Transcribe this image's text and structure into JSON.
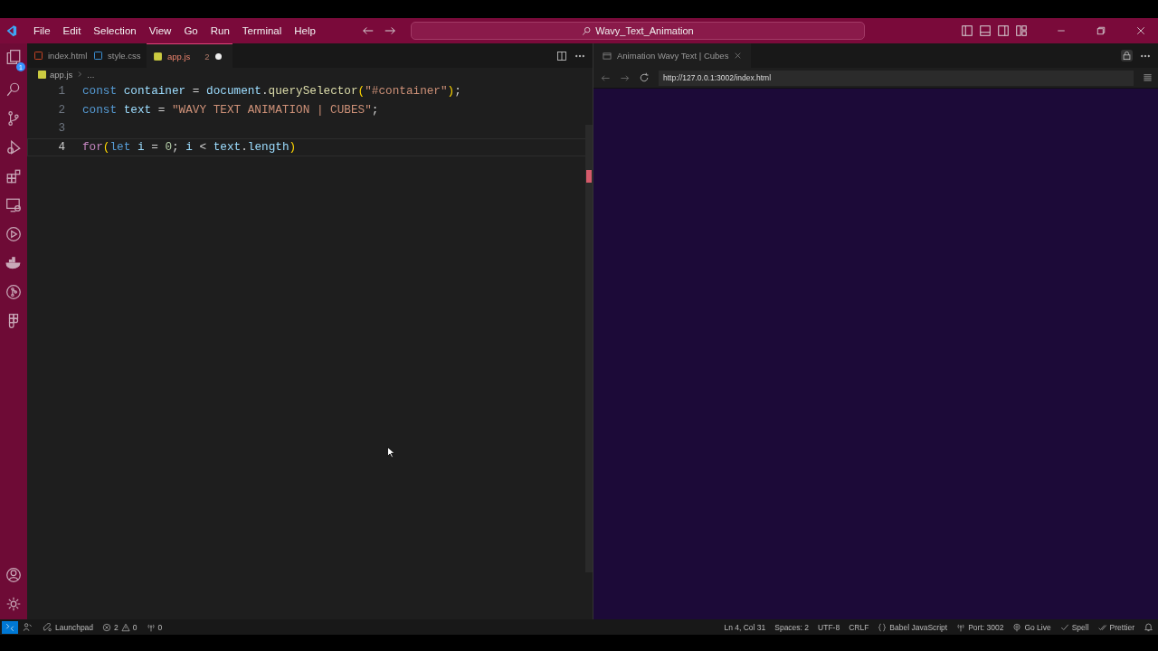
{
  "menu": [
    "File",
    "Edit",
    "Selection",
    "View",
    "Go",
    "Run",
    "Terminal",
    "Help"
  ],
  "command_center": {
    "title": "Wavy_Text_Animation"
  },
  "activity_bar": {
    "explorer_badge": "1"
  },
  "editor_tabs": [
    {
      "label": "index.html",
      "kind": "html",
      "selected": false
    },
    {
      "label": "style.css",
      "kind": "css",
      "selected": false
    },
    {
      "label": "app.js",
      "kind": "js",
      "selected": true,
      "problems": "2",
      "modified": true
    }
  ],
  "breadcrumbs": {
    "file": "app.js",
    "rest": "..."
  },
  "code": [
    {
      "number": "1",
      "tokens": [
        {
          "kind": "keyword",
          "text": "const "
        },
        {
          "kind": "variable",
          "text": "container"
        },
        {
          "kind": "plain",
          "text": " = "
        },
        {
          "kind": "variable",
          "text": "document"
        },
        {
          "kind": "plain",
          "text": "."
        },
        {
          "kind": "function",
          "text": "querySelector"
        },
        {
          "kind": "bracket",
          "text": "("
        },
        {
          "kind": "string",
          "text": "\"#container\""
        },
        {
          "kind": "bracket",
          "text": ")"
        },
        {
          "kind": "plain",
          "text": ";"
        }
      ]
    },
    {
      "number": "2",
      "tokens": [
        {
          "kind": "keyword",
          "text": "const "
        },
        {
          "kind": "variable",
          "text": "text"
        },
        {
          "kind": "plain",
          "text": " = "
        },
        {
          "kind": "string",
          "text": "\"WAVY TEXT ANIMATION | CUBES\""
        },
        {
          "kind": "plain",
          "text": ";"
        }
      ]
    },
    {
      "number": "3"
    },
    {
      "number": "4",
      "current": true,
      "tokens": [
        {
          "kind": "control",
          "text": "for"
        },
        {
          "kind": "bracket",
          "text": "("
        },
        {
          "kind": "keyword",
          "text": "let "
        },
        {
          "kind": "variable",
          "text": "i"
        },
        {
          "kind": "plain",
          "text": " = "
        },
        {
          "kind": "number",
          "text": "0"
        },
        {
          "kind": "plain",
          "text": "; "
        },
        {
          "kind": "variable",
          "text": "i"
        },
        {
          "kind": "plain",
          "text": " < "
        },
        {
          "kind": "variable",
          "text": "text"
        },
        {
          "kind": "plain",
          "text": "."
        },
        {
          "kind": "variable",
          "text": "length"
        },
        {
          "kind": "bracket",
          "text": ")"
        }
      ]
    }
  ],
  "browser": {
    "tab": "Animation Wavy Text | Cubes",
    "url": "http://127.0.0.1:3002/index.html"
  },
  "status_left": [
    {
      "kind": "launchpad",
      "text": "Launchpad"
    },
    {
      "kind": "problems",
      "errors": "2",
      "warnings": "0"
    },
    {
      "kind": "ports",
      "text": "0"
    }
  ],
  "status_right": [
    {
      "kind": "plain",
      "text": "Ln 4, Col 31"
    },
    {
      "kind": "plain",
      "text": "Spaces: 2"
    },
    {
      "kind": "plain",
      "text": "UTF-8"
    },
    {
      "kind": "plain",
      "text": "CRLF"
    },
    {
      "kind": "braces",
      "text": "Babel JavaScript"
    },
    {
      "kind": "port",
      "text": "Port: 3002"
    },
    {
      "kind": "live",
      "text": "Go Live"
    },
    {
      "kind": "check",
      "text": "Spell"
    },
    {
      "kind": "doublecheck",
      "text": "Prettier"
    },
    {
      "kind": "bell"
    }
  ]
}
